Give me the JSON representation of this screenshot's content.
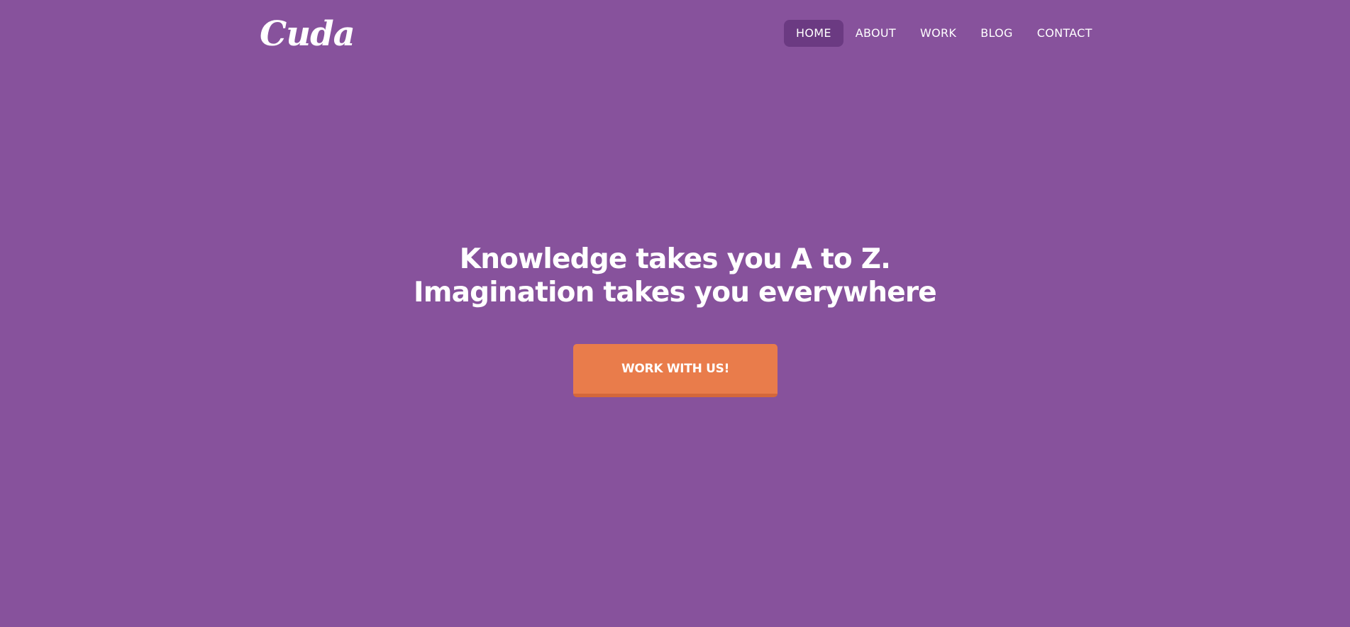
{
  "header": {
    "logo_text": "Cuda",
    "nav": [
      {
        "label": "HOME",
        "active": true
      },
      {
        "label": "ABOUT",
        "active": false
      },
      {
        "label": "WORK",
        "active": false
      },
      {
        "label": "BLOG",
        "active": false
      },
      {
        "label": "CONTACT",
        "active": false
      }
    ]
  },
  "hero": {
    "line1": "Knowledge takes you A to Z.",
    "line2": "Imagination takes you everywhere",
    "cta_label": "WORK WITH US!"
  },
  "colors": {
    "background": "#87529c",
    "nav_active_bg": "#6b3a82",
    "cta_bg": "#e97c4b",
    "cta_border": "#d4673b",
    "text": "#ffffff"
  }
}
